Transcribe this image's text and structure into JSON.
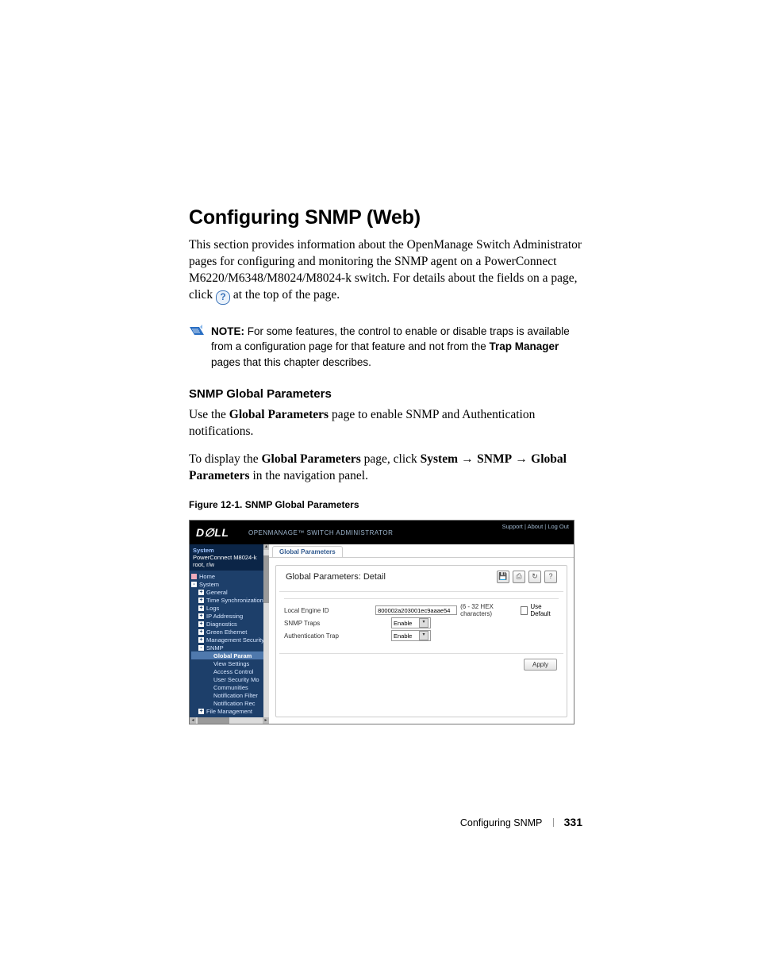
{
  "heading": "Configuring SNMP (Web)",
  "intro_pre": "This section provides information about the OpenManage Switch Administrator pages for configuring and monitoring the SNMP agent on a PowerConnect M6220/M6348/M8024/M8024-k switch. For details about the fields on a page, click ",
  "intro_post": " at the top of the page.",
  "note_label": "NOTE: ",
  "note_body_1": "For some features, the control to enable or disable traps is available from a configuration page for that feature and not from the ",
  "note_bold": "Trap Manager",
  "note_body_2": " pages that this chapter describes.",
  "h2": "SNMP Global Parameters",
  "p1_pre": "Use the ",
  "p1_bold": "Global Parameters",
  "p1_post": " page to enable SNMP and Authentication notifications.",
  "p2_a": "To display the ",
  "p2_b1": "Global Parameters",
  "p2_b": " page, click ",
  "p2_s1": "System",
  "p2_arr": " → ",
  "p2_s2": "SNMP",
  "p2_s3": "Global Parameters",
  "p2_c": " in the navigation panel.",
  "fig": "Figure 12-1.    SNMP Global Parameters",
  "app": {
    "title": "OPENMANAGE™ SWITCH ADMINISTRATOR",
    "links": {
      "support": "Support",
      "about": "About",
      "logout": "Log Out"
    },
    "sidebar_head_1": "System",
    "sidebar_head_2": "PowerConnect M8024-k",
    "sidebar_head_3": "root, r/w",
    "tab": "Global Parameters",
    "panel_title": "Global Parameters: Detail",
    "form": {
      "engine_label": "Local Engine ID",
      "engine_value": "800002a203001ec9aaae54",
      "engine_hint": "(6 - 32 HEX characters)",
      "use_default": "Use Default",
      "snmp_traps_label": "SNMP Traps",
      "snmp_traps_value": "Enable",
      "auth_trap_label": "Authentication Trap",
      "auth_trap_value": "Enable",
      "apply": "Apply"
    },
    "tree": [
      {
        "ind": 0,
        "box": "",
        "label": "Home",
        "cls": "home"
      },
      {
        "ind": 0,
        "box": "-",
        "label": "System"
      },
      {
        "ind": 1,
        "box": "+",
        "label": "General"
      },
      {
        "ind": 1,
        "box": "+",
        "label": "Time Synchronization"
      },
      {
        "ind": 1,
        "box": "+",
        "label": "Logs"
      },
      {
        "ind": 1,
        "box": "+",
        "label": "IP Addressing"
      },
      {
        "ind": 1,
        "box": "+",
        "label": "Diagnostics"
      },
      {
        "ind": 1,
        "box": "+",
        "label": "Green Ethernet"
      },
      {
        "ind": 1,
        "box": "+",
        "label": "Management Security"
      },
      {
        "ind": 1,
        "box": "-",
        "label": "SNMP"
      },
      {
        "ind": 2,
        "box": "",
        "label": "Global Param",
        "sel": true
      },
      {
        "ind": 2,
        "box": "",
        "label": "View Settings"
      },
      {
        "ind": 2,
        "box": "",
        "label": "Access Control"
      },
      {
        "ind": 2,
        "box": "",
        "label": "User Security Mo"
      },
      {
        "ind": 2,
        "box": "",
        "label": "Communities"
      },
      {
        "ind": 2,
        "box": "",
        "label": "Notification Filter"
      },
      {
        "ind": 2,
        "box": "",
        "label": "Notification Rec"
      },
      {
        "ind": 1,
        "box": "+",
        "label": "File Management"
      }
    ]
  },
  "footer_section": "Configuring SNMP",
  "footer_page": "331"
}
